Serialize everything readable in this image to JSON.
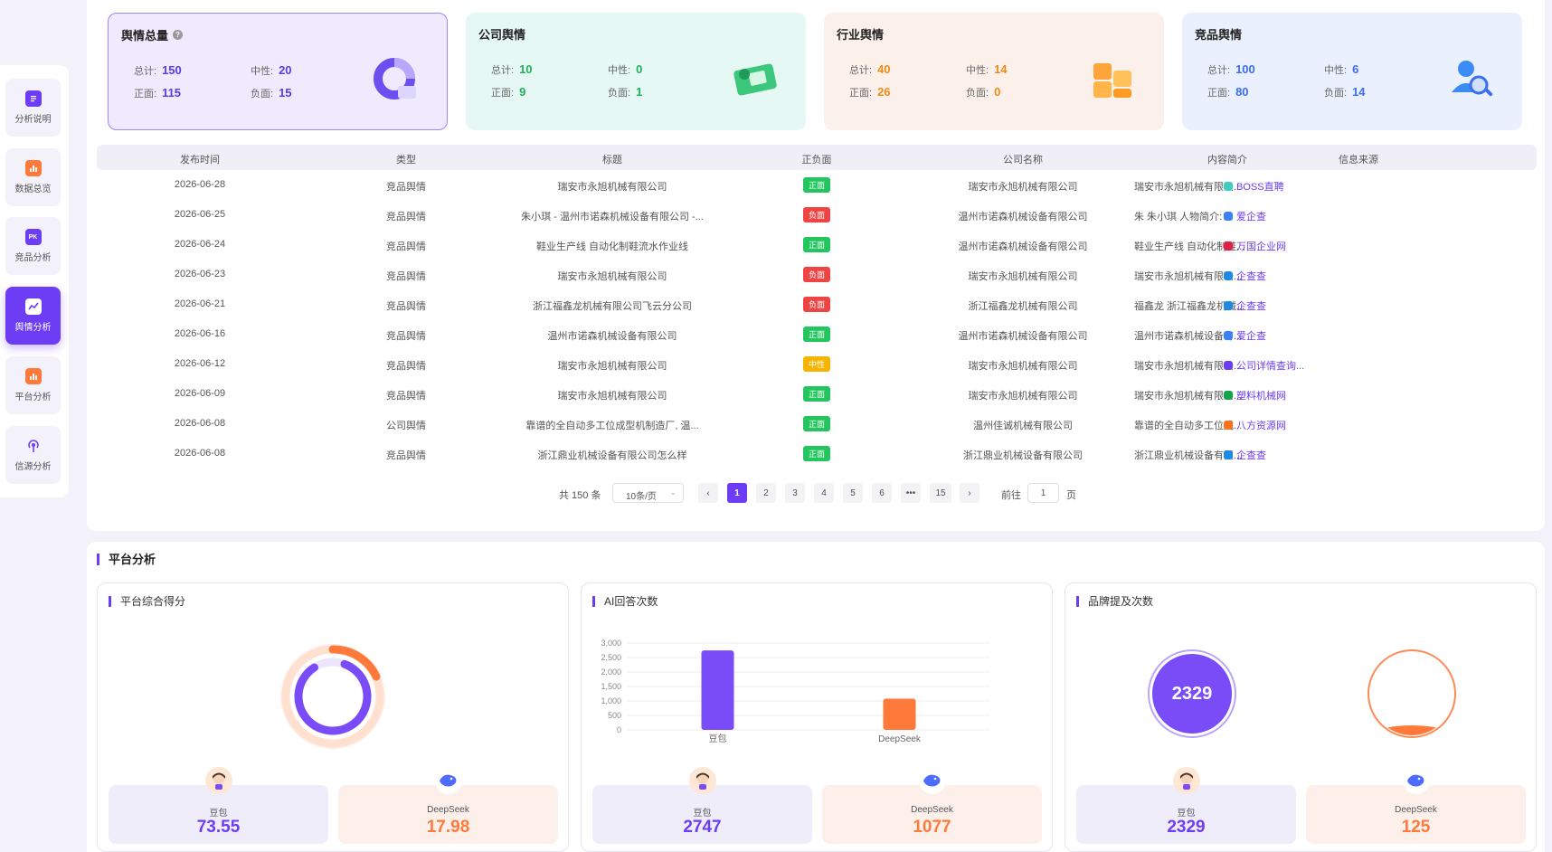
{
  "sidebar": {
    "items": [
      {
        "label": "分析说明",
        "icon": "document-icon",
        "color": "#6d3cf5"
      },
      {
        "label": "数据总览",
        "icon": "bar-chart-icon",
        "color": "#ff7a3a"
      },
      {
        "label": "竞品分析",
        "icon": "pk-icon",
        "color": "#6d3cf5"
      },
      {
        "label": "舆情分析",
        "icon": "trend-icon",
        "color": "#ffffff"
      },
      {
        "label": "平台分析",
        "icon": "bar-chart-icon",
        "color": "#ff7a3a"
      },
      {
        "label": "信源分析",
        "icon": "broadcast-icon",
        "color": "#6d3cf5"
      }
    ]
  },
  "cards": [
    {
      "title": "舆情总量",
      "total_label": "总计:",
      "total": "150",
      "neutral_label": "中性:",
      "neutral": "20",
      "pos_label": "正面:",
      "pos": "115",
      "neg_label": "负面:",
      "neg": "15",
      "color": "#5a3be0",
      "bg": "#efeafd"
    },
    {
      "title": "公司舆情",
      "total_label": "总计:",
      "total": "10",
      "neutral_label": "中性:",
      "neutral": "0",
      "pos_label": "正面:",
      "pos": "9",
      "neg_label": "负面:",
      "neg": "1",
      "color": "#1fb15b",
      "bg": "#e6f8f3"
    },
    {
      "title": "行业舆情",
      "total_label": "总计:",
      "total": "40",
      "neutral_label": "中性:",
      "neutral": "14",
      "pos_label": "正面:",
      "pos": "26",
      "neg_label": "负面:",
      "neg": "0",
      "color": "#f08a16",
      "bg": "#fcf1ea"
    },
    {
      "title": "竞品舆情",
      "total_label": "总计:",
      "total": "100",
      "neutral_label": "中性:",
      "neutral": "6",
      "pos_label": "正面:",
      "pos": "80",
      "neg_label": "负面:",
      "neg": "14",
      "color": "#3b6df0",
      "bg": "#eaf0fd"
    }
  ],
  "table": {
    "headers": [
      "发布时间",
      "类型",
      "标题",
      "正负面",
      "公司名称",
      "内容简介",
      "信息来源"
    ],
    "rows": [
      {
        "date": "2026-06-28",
        "type": "竞品舆情",
        "title": "瑞安市永旭机械有限公司",
        "sentiment": "正面",
        "company": "瑞安市永旭机械有限公司",
        "intro": "瑞安市永旭机械有限公...",
        "source": "BOSS直聘"
      },
      {
        "date": "2026-06-25",
        "type": "竞品舆情",
        "title": "朱小琪 - 温州市诺森机械设备有限公司 -...",
        "sentiment": "负面",
        "company": "温州市诺森机械设备有限公司",
        "intro": "朱 朱小琪 人物简介: ...",
        "source": "爱企查"
      },
      {
        "date": "2026-06-24",
        "type": "竞品舆情",
        "title": "鞋业生产线 自动化制鞋流水作业线",
        "sentiment": "正面",
        "company": "温州市诺森机械设备有限公司",
        "intro": "鞋业生产线 自动化制鞋...",
        "source": "万国企业网"
      },
      {
        "date": "2026-06-23",
        "type": "竞品舆情",
        "title": "瑞安市永旭机械有限公司",
        "sentiment": "负面",
        "company": "瑞安市永旭机械有限公司",
        "intro": "瑞安市永旭机械有限公...",
        "source": "企查查"
      },
      {
        "date": "2026-06-21",
        "type": "竞品舆情",
        "title": "浙江福鑫龙机械有限公司飞云分公司",
        "sentiment": "负面",
        "company": "浙江福鑫龙机械有限公司",
        "intro": "福鑫龙 浙江福鑫龙机械...",
        "source": "企查查"
      },
      {
        "date": "2026-06-16",
        "type": "竞品舆情",
        "title": "温州市诺森机械设备有限公司",
        "sentiment": "正面",
        "company": "温州市诺森机械设备有限公司",
        "intro": "温州市诺森机械设备有...",
        "source": "爱企查"
      },
      {
        "date": "2026-06-12",
        "type": "竞品舆情",
        "title": "瑞安市永旭机械有限公司",
        "sentiment": "中性",
        "company": "瑞安市永旭机械有限公司",
        "intro": "瑞安市永旭机械有限公...",
        "source": "公司详情查询..."
      },
      {
        "date": "2026-06-09",
        "type": "竞品舆情",
        "title": "瑞安市永旭机械有限公司",
        "sentiment": "正面",
        "company": "瑞安市永旭机械有限公司",
        "intro": "瑞安市永旭机械有限公...",
        "source": "塑料机械网"
      },
      {
        "date": "2026-06-08",
        "type": "公司舆情",
        "title": "靠谱的全自动多工位成型机制造厂, 温...",
        "sentiment": "正面",
        "company": "温州佳诚机械有限公司",
        "intro": "靠谱的全自动多工位成...",
        "source": "八方资源网"
      },
      {
        "date": "2026-06-08",
        "type": "竞品舆情",
        "title": "浙江鼎业机械设备有限公司怎么样",
        "sentiment": "正面",
        "company": "浙江鼎业机械设备有限公司",
        "intro": "浙江鼎业机械设备有限...",
        "source": "企查查"
      }
    ],
    "sentiment_colors": {
      "正面": "#22c55e",
      "负面": "#ef4444",
      "中性": "#f5b400"
    },
    "source_colors": {
      "BOSS直聘": "#3ccfbf",
      "爱企查": "#3b82f6",
      "万国企业网": "#e11d48",
      "企查查": "#1e88e5",
      "公司详情查询...": "#6d3cf5",
      "塑料机械网": "#16a34a",
      "八方资源网": "#f97316"
    }
  },
  "pagination": {
    "total": "共 150 条",
    "page_size": "10条/页",
    "pages": [
      "1",
      "2",
      "3",
      "4",
      "5",
      "6",
      "•••",
      "15"
    ],
    "goto_label": "前往",
    "goto_value": "1",
    "page_unit": "页"
  },
  "platform": {
    "title": "平台分析",
    "score": {
      "title": "平台综合得分",
      "items": [
        {
          "name": "豆包",
          "value": "73.55"
        },
        {
          "name": "DeepSeek",
          "value": "17.98"
        }
      ]
    },
    "ai": {
      "title": "AI回答次数",
      "items": [
        {
          "name": "豆包",
          "value": "2747"
        },
        {
          "name": "DeepSeek",
          "value": "1077"
        }
      ]
    },
    "brand": {
      "title": "品牌提及次数",
      "center_value": "2329",
      "items": [
        {
          "name": "豆包",
          "value": "2329"
        },
        {
          "name": "DeepSeek",
          "value": "125"
        }
      ]
    }
  },
  "chart_data": {
    "type": "bar",
    "categories": [
      "豆包",
      "DeepSeek"
    ],
    "values": [
      2747,
      1077
    ],
    "ylim": [
      0,
      3000
    ],
    "yticks": [
      "3,000",
      "2,500",
      "2,000",
      "1,500",
      "1,000",
      "500",
      "0"
    ],
    "colors": [
      "#7a4cf7",
      "#ff7a3a"
    ],
    "grid": true
  }
}
